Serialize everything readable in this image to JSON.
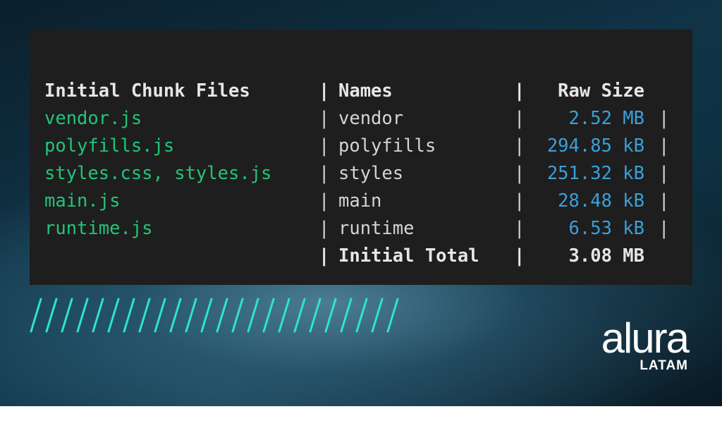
{
  "table": {
    "header": {
      "files": "Initial Chunk Files",
      "names": "Names",
      "raw_size": "Raw Size"
    },
    "separator": "|",
    "rows": [
      {
        "file": "vendor.js",
        "name": "vendor",
        "size": "2.52 MB"
      },
      {
        "file": "polyfills.js",
        "name": "polyfills",
        "size": "294.85 kB"
      },
      {
        "file": "styles.css, styles.js",
        "name": "styles",
        "size": "251.32 kB"
      },
      {
        "file": "main.js",
        "name": "main",
        "size": "28.48 kB"
      },
      {
        "file": "runtime.js",
        "name": "runtime",
        "size": "6.53 kB"
      }
    ],
    "total": {
      "label": "Initial Total",
      "value": "3.08 MB"
    }
  },
  "logo": {
    "word": "alura",
    "sub": "LATAM"
  },
  "colors": {
    "file_text": "#23c47a",
    "size_text": "#3aa0d8",
    "terminal_bg": "#1e1e1e",
    "stripes": "#2ee6c8"
  }
}
